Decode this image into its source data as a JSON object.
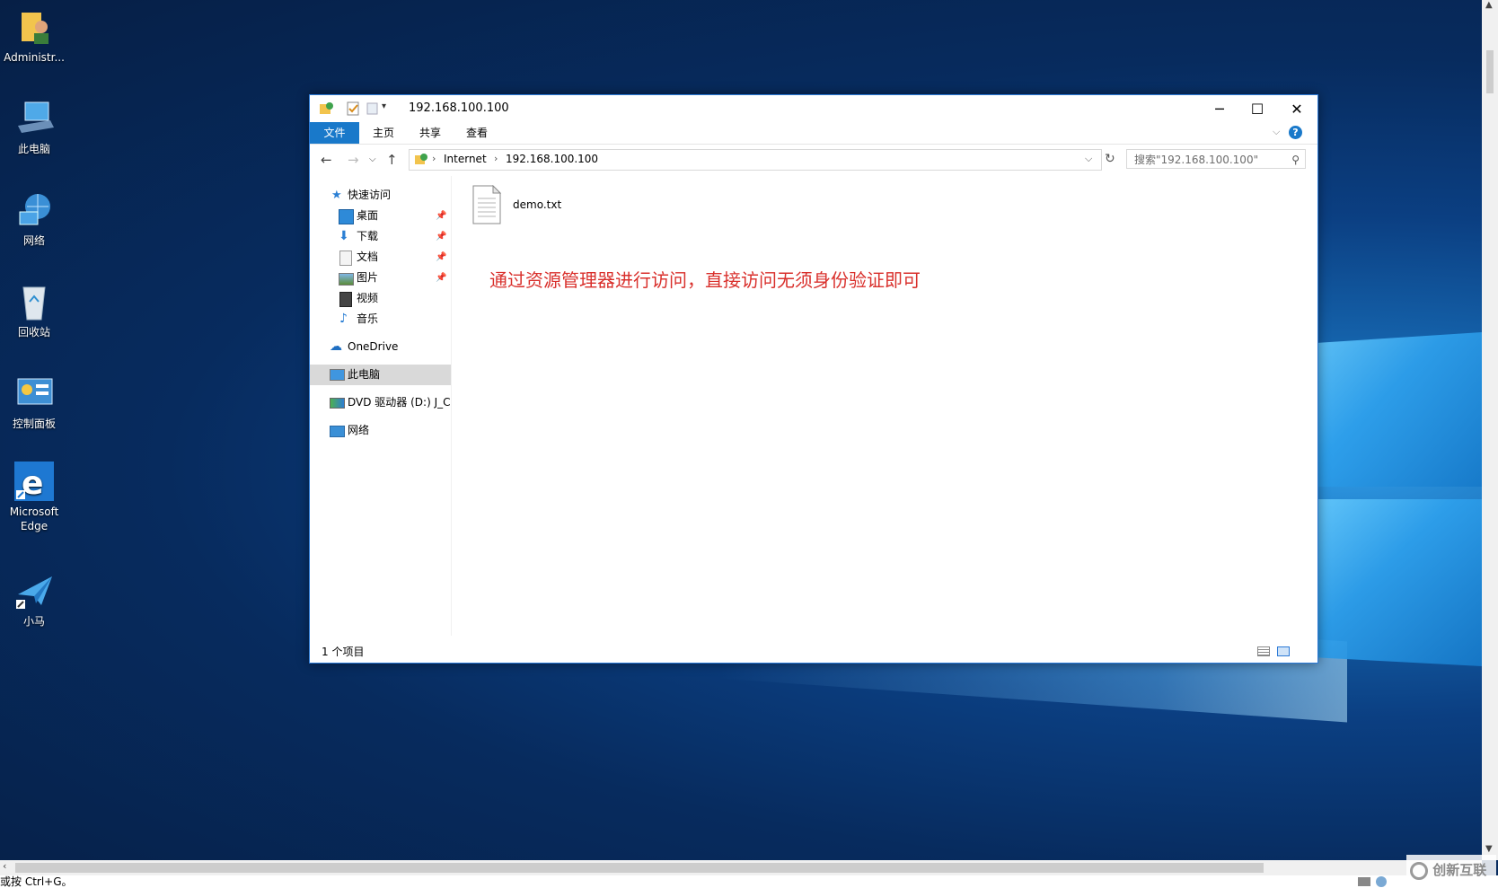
{
  "desktop": {
    "icons": [
      {
        "label": "Administr..."
      },
      {
        "label": "此电脑"
      },
      {
        "label": "网络"
      },
      {
        "label": "回收站"
      },
      {
        "label": "控制面板"
      },
      {
        "label": "Microsoft Edge"
      },
      {
        "label": "小马"
      }
    ]
  },
  "window": {
    "title": "192.168.100.100",
    "ribbon_tabs": [
      "文件",
      "主页",
      "共享",
      "查看"
    ],
    "address": {
      "segments": [
        "Internet",
        "192.168.100.100"
      ]
    },
    "search_placeholder": "搜索\"192.168.100.100\"",
    "nav": {
      "quick_access": "快速访问",
      "quick_items": [
        "桌面",
        "下载",
        "文档",
        "图片",
        "视频",
        "音乐"
      ],
      "onedrive": "OneDrive",
      "this_pc": "此电脑",
      "dvd": "DVD 驱动器 (D:) J_C",
      "network": "网络"
    },
    "files": [
      {
        "name": "demo.txt"
      }
    ],
    "annotation": "通过资源管理器进行访问，直接访问无须身份验证即可",
    "status": "1 个项目"
  },
  "bottom_status": "或按 Ctrl+G。",
  "watermark": "创新互联",
  "colors": {
    "accent": "#1979ca",
    "annotation": "#d9302c",
    "selection": "#d9d9d9"
  }
}
